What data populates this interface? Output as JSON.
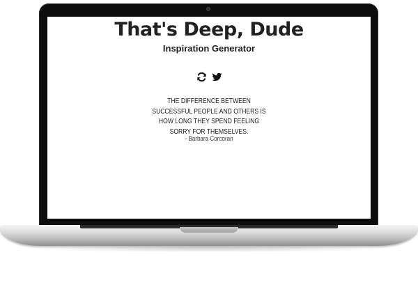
{
  "app": {
    "title": "That's Deep, Dude",
    "subtitle": "Inspiration Generator"
  },
  "actions": {
    "refresh_icon": "refresh-icon",
    "twitter_icon": "twitter-icon"
  },
  "quote": {
    "text": "The difference between successful people and others is how long they spend feeling sorry for themselves.",
    "author": "- Barbara Corcoran"
  },
  "colors": {
    "text": "#222222",
    "bezel": "#0d0d0d",
    "screen_bg": "#ffffff"
  }
}
